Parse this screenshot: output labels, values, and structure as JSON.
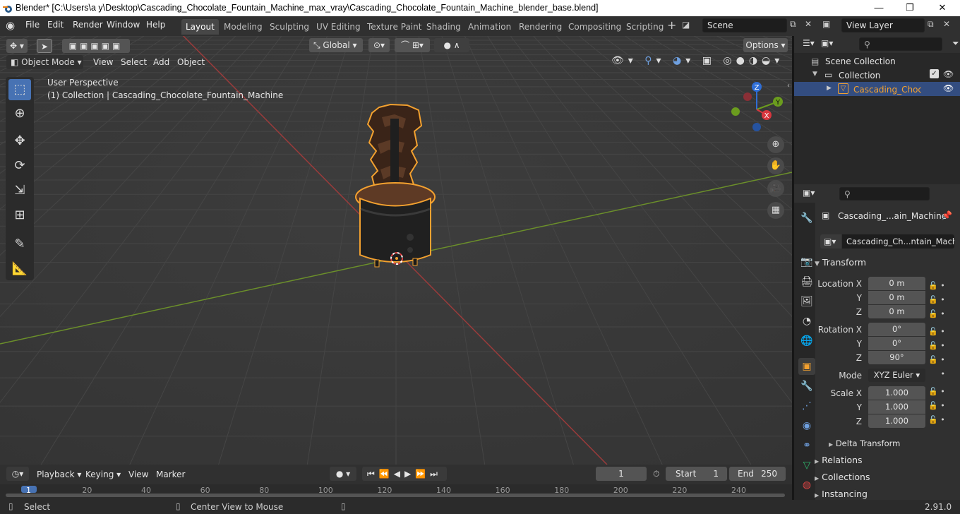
{
  "window": {
    "title": "Blender* [C:\\Users\\a y\\Desktop\\Cascading_Chocolate_Fountain_Machine_max_vray\\Cascading_Chocolate_Fountain_Machine_blender_base.blend]",
    "minimize": "—",
    "maximize": "❐",
    "close": "✕"
  },
  "menu": [
    "File",
    "Edit",
    "Render",
    "Window",
    "Help"
  ],
  "workspaces": [
    "Layout",
    "Modeling",
    "Sculpting",
    "UV Editing",
    "Texture Paint",
    "Shading",
    "Animation",
    "Rendering",
    "Compositing",
    "Scripting"
  ],
  "scene": {
    "label": "Scene",
    "view_layer": "View Layer"
  },
  "viewport": {
    "mode": "Object Mode",
    "menus": [
      "View",
      "Select",
      "Add",
      "Object"
    ],
    "orientation": "Global",
    "options": "Options",
    "overlay_title": "User Perspective",
    "overlay_collection": "(1) Collection | Cascading_Chocolate_Fountain_Machine",
    "gizmo": {
      "x": "X",
      "y": "Y",
      "z": "Z"
    }
  },
  "outliner": {
    "scene_collection": "Scene Collection",
    "collection": "Collection",
    "object": "Cascading_Chocolate_Fountain_Machine"
  },
  "properties": {
    "object_name": "Cascading_...ain_Machine",
    "data_name": "Cascading_Ch...ntain_Machine",
    "transform_title": "Transform",
    "location_label": "Location X",
    "rotation_label": "Rotation X",
    "scale_label": "Scale X",
    "axis_y": "Y",
    "axis_z": "Z",
    "location": [
      "0 m",
      "0 m",
      "0 m"
    ],
    "rotation": [
      "0°",
      "0°",
      "90°"
    ],
    "scale": [
      "1.000",
      "1.000",
      "1.000"
    ],
    "mode_label": "Mode",
    "mode_value": "XYZ Euler",
    "delta": "Delta Transform",
    "panels": [
      "Relations",
      "Collections",
      "Instancing"
    ]
  },
  "timeline": {
    "menus": [
      "Playback",
      "Keying",
      "View",
      "Marker"
    ],
    "current_frame": "1",
    "start_label": "Start",
    "start": "1",
    "end_label": "End",
    "end": "250",
    "ruler": [
      "1",
      "20",
      "40",
      "60",
      "80",
      "100",
      "120",
      "140",
      "160",
      "180",
      "200",
      "220",
      "240"
    ]
  },
  "status": {
    "select": "Select",
    "center": "Center View to Mouse",
    "version": "2.91.0"
  }
}
